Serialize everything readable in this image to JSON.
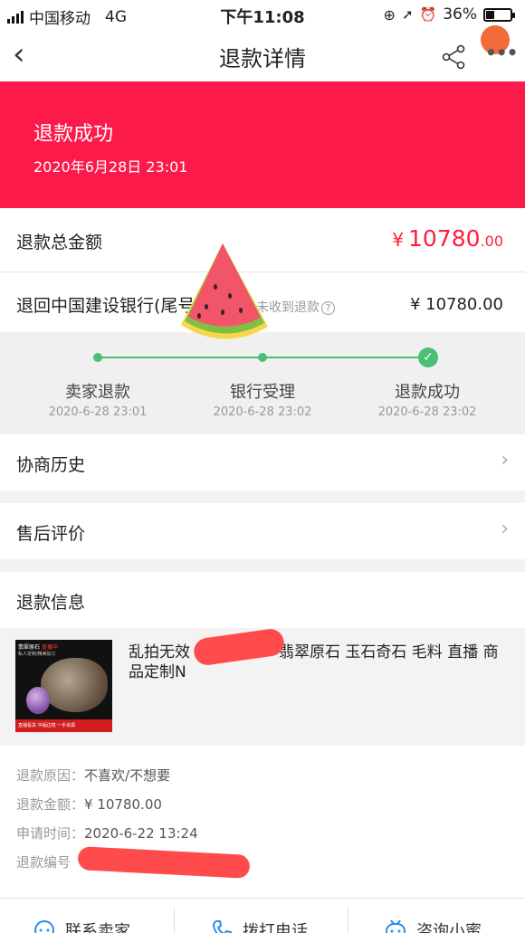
{
  "status_bar": {
    "carrier": "中国移动",
    "network": "4G",
    "time": "下午11:08",
    "battery": "36%",
    "battery_level": 0.36
  },
  "nav": {
    "title": "退款详情"
  },
  "banner": {
    "status": "退款成功",
    "time": "2020年6月28日 23:01",
    "color": "#fc1a4b"
  },
  "total": {
    "label": "退款总金额",
    "currency": "¥",
    "integer": "10780",
    "decimal": ".00"
  },
  "bank": {
    "label": "退回中国建设银行(尾号",
    "hint": "未收到退款",
    "amount": "¥ 10780.00"
  },
  "progress": {
    "steps": [
      {
        "name": "卖家退款",
        "date": "2020-6-28 23:01"
      },
      {
        "name": "银行受理",
        "date": "2020-6-28 23:02"
      },
      {
        "name": "退款成功",
        "date": "2020-6-28 23:02"
      }
    ],
    "accent": "#4bbf73"
  },
  "menu": {
    "history": "协商历史",
    "review": "售后评价"
  },
  "refund_info": {
    "section_title": "退款信息",
    "product_name_pre": "乱拍无效",
    "product_name_post": "翡翠原石 玉石奇石 毛料 直播 商品定制N",
    "thumb": {
      "tag_a": "翡翠原石",
      "tag_b": "直播中",
      "sub": "私人定制/精美加工",
      "footer": "直播看货  中缅边境  一手资源"
    },
    "reason_label": "退款原因：",
    "reason": "不喜欢/不想要",
    "amount_label": "退款金额：",
    "amount": "¥ 10780.00",
    "time_label": "申请时间：",
    "time": "2020-6-22 13:24",
    "number_label": "退款编号"
  },
  "toolbar": {
    "contact": "联系卖家",
    "call": "拨打电话",
    "ask": "咨询小蜜"
  }
}
